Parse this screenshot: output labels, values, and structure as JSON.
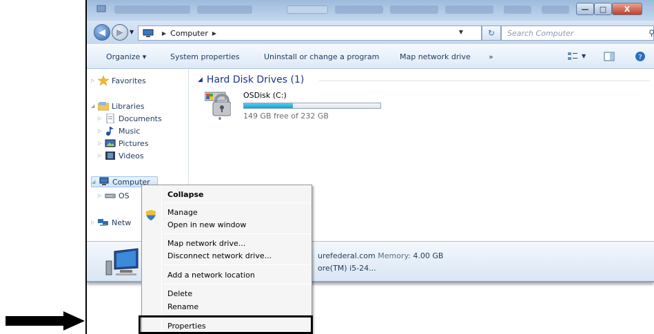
{
  "window": {
    "address": {
      "computer": "Computer"
    },
    "search_placeholder": "Search Computer",
    "controls": {
      "minimize": "—",
      "maximize": "□",
      "close": "X"
    }
  },
  "toolbar": {
    "organize": "Organize ▾",
    "system_properties": "System properties",
    "uninstall": "Uninstall or change a program",
    "map_drive": "Map network drive",
    "more": "»"
  },
  "nav": {
    "favorites": "Favorites",
    "libraries": "Libraries",
    "documents": "Documents",
    "music": "Music",
    "pictures": "Pictures",
    "videos": "Videos",
    "computer": "Computer",
    "osdisk_partial": "OS",
    "network_partial": "Netw"
  },
  "main": {
    "group_title": "Hard Disk Drives (1)",
    "drive": {
      "name": "OSDisk (C:)",
      "free_text": "149 GB free of 232 GB",
      "used_fraction": 0.36
    }
  },
  "details": {
    "domain_partial": "urefederal.com",
    "memory_label": "Memory:",
    "memory_value": "4.00 GB",
    "processor_partial": "ore(TM) i5-24..."
  },
  "context_menu": {
    "items": [
      "Collapse",
      "Manage",
      "Open in new window",
      "Map network drive...",
      "Disconnect network drive...",
      "Add a network location",
      "Delete",
      "Rename",
      "Properties"
    ]
  },
  "colors": {
    "accent": "#1e395b",
    "highlight_border": "#000000",
    "drive_fill": "#1a9bd0"
  }
}
